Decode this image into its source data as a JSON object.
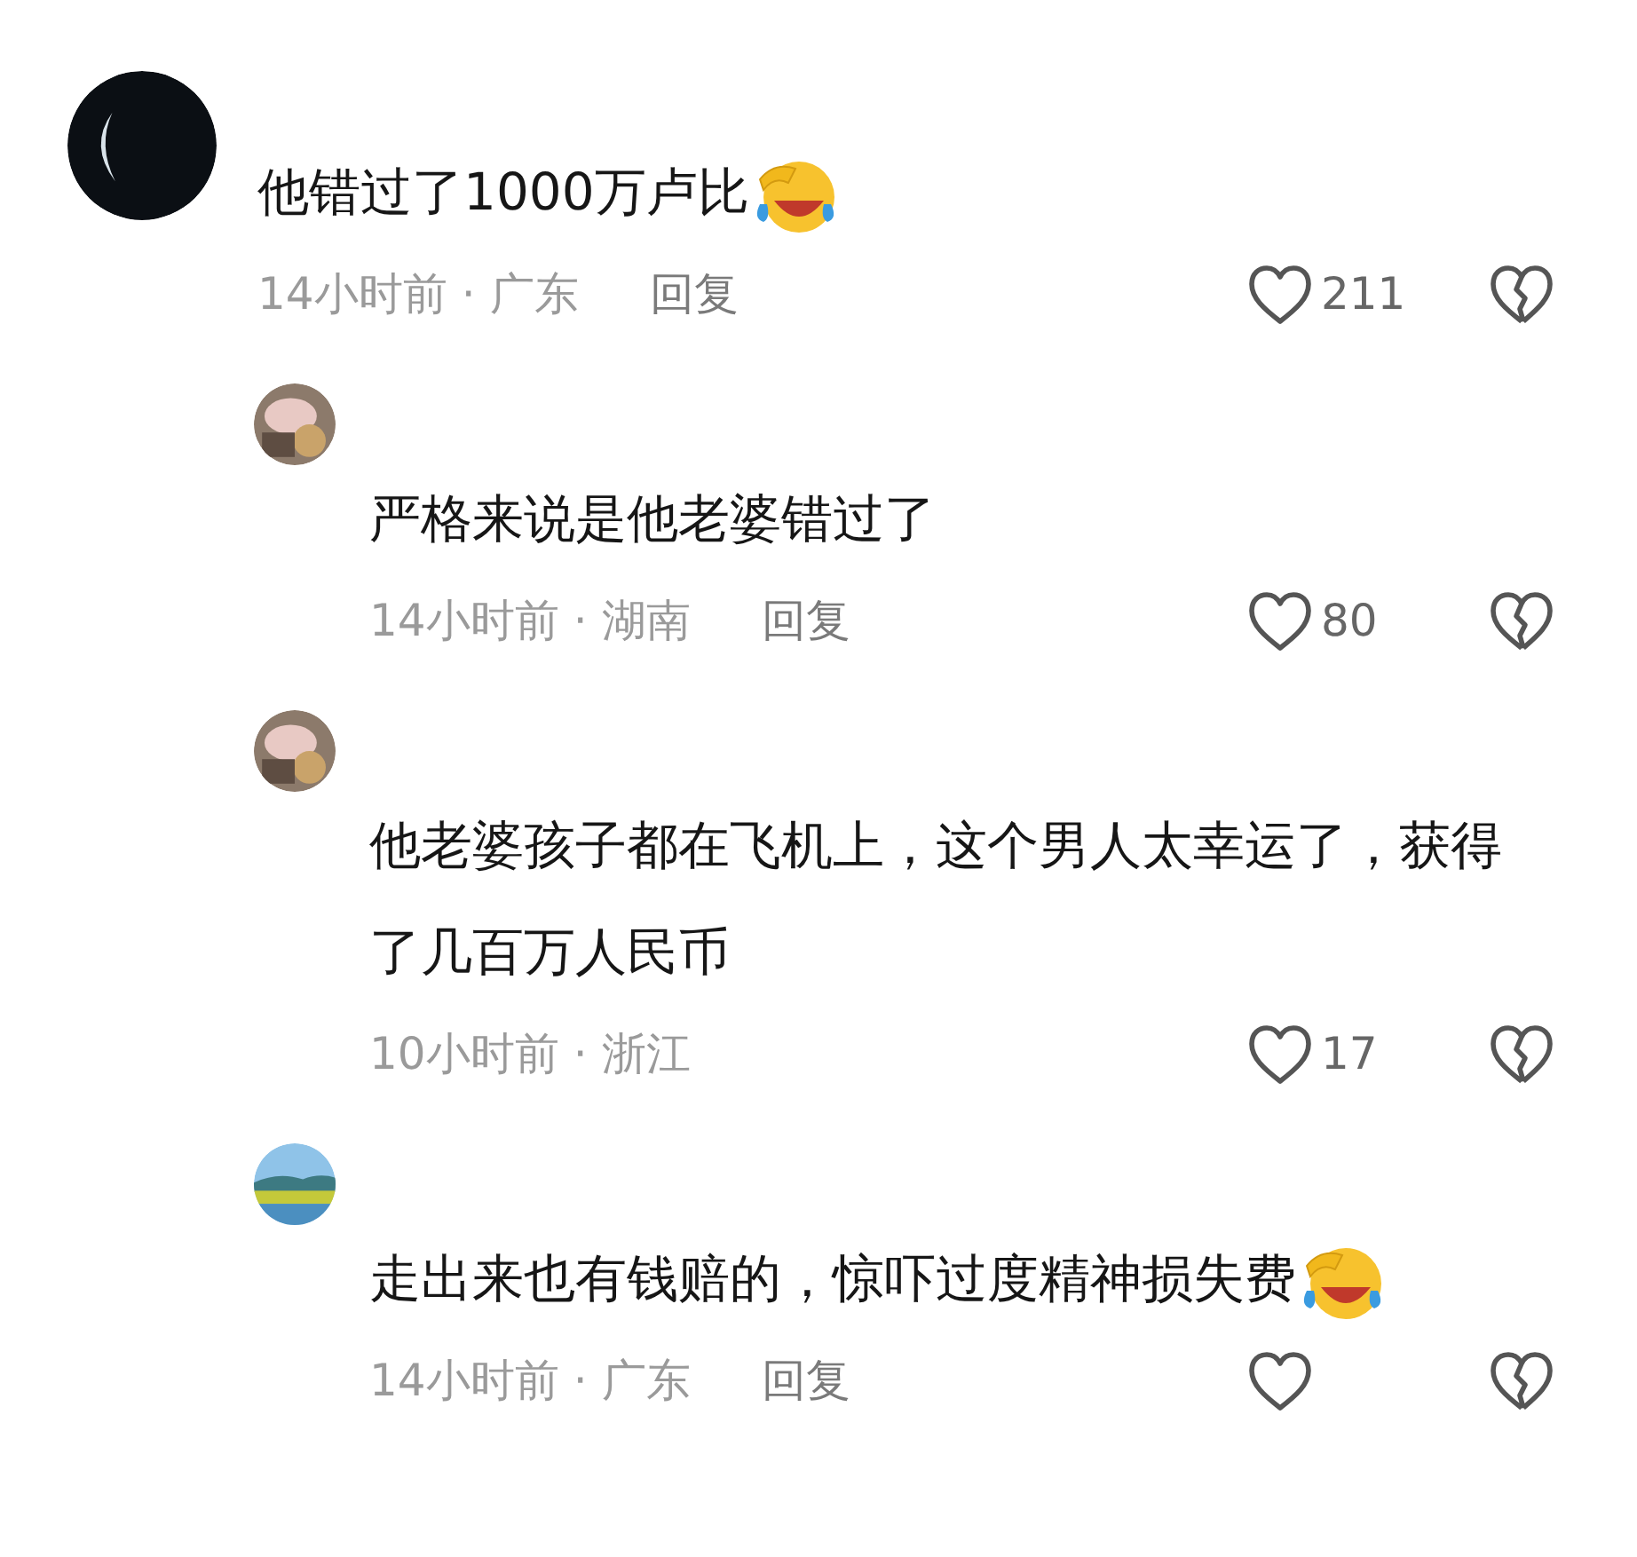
{
  "comments": [
    {
      "kind": "top",
      "text": "他错过了1000万卢比",
      "emoji": true,
      "time": "14小时前",
      "separator": "·",
      "region": "广东",
      "reply": "回复",
      "likes": "211"
    },
    {
      "kind": "reply",
      "text": "严格来说是他老婆错过了",
      "emoji": false,
      "time": "14小时前",
      "separator": "·",
      "region": "湖南",
      "reply": "回复",
      "likes": "80"
    },
    {
      "kind": "reply",
      "text": "他老婆孩子都在飞机上，这个男人太幸运了，获得了几百万人民币",
      "emoji": false,
      "time": "10小时前",
      "separator": "·",
      "region": "浙江",
      "likes": "17"
    },
    {
      "kind": "reply",
      "text": "走出来也有钱赔的，惊吓过度精神损失费",
      "emoji": true,
      "time": "14小时前",
      "separator": "·",
      "region": "广东",
      "reply": "回复"
    }
  ]
}
